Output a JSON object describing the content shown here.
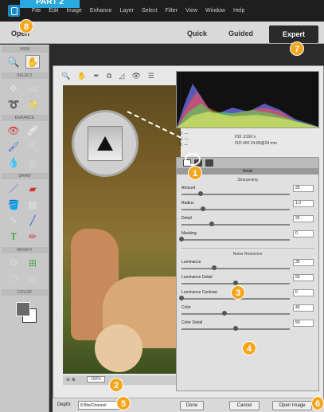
{
  "banner": "PART 2",
  "menu": [
    "File",
    "Edit",
    "Image",
    "Enhance",
    "Layer",
    "Select",
    "Filter",
    "View",
    "Window",
    "Help"
  ],
  "modebar": {
    "open": "Open",
    "quick": "Quick",
    "guided": "Guided",
    "expert": "Expert"
  },
  "tool_sections": [
    "VIEW",
    "SELECT",
    "ENHANCE",
    "DRAW",
    "MODIFY",
    "COLOR"
  ],
  "readout": {
    "r": "R:",
    "g": "G:",
    "b": "B:",
    "dashes": "---",
    "exposure": "f/16  1/160 s",
    "iso": "ISO 400  24-85@24 mm"
  },
  "panel": {
    "title": "Detail",
    "sharpening_title": "Sharpening",
    "sharpening": [
      {
        "label": "Amount",
        "value": "25",
        "pos": 0.18
      },
      {
        "label": "Radius",
        "value": "1.0",
        "pos": 0.2
      },
      {
        "label": "Detail",
        "value": "25",
        "pos": 0.28
      },
      {
        "label": "Masking",
        "value": "0",
        "pos": 0.0
      }
    ],
    "noise_title": "Noise Reduction",
    "noise": [
      {
        "label": "Luminance",
        "value": "30",
        "pos": 0.3
      },
      {
        "label": "Luminance Detail",
        "value": "50",
        "pos": 0.5
      },
      {
        "label": "Luminance Contrast",
        "value": "0",
        "pos": 0.0
      },
      {
        "label": "Color",
        "value": "40",
        "pos": 0.4
      },
      {
        "label": "Color Detail",
        "value": "50",
        "pos": 0.5
      }
    ]
  },
  "zoom": {
    "value": "100%"
  },
  "footer": {
    "depth_label": "Depth:",
    "depth_value": "8 Bits/Channel",
    "done": "Done",
    "cancel": "Cancel",
    "open_image": "Open Image"
  },
  "badges": [
    "1",
    "2",
    "3",
    "4",
    "5",
    "6",
    "7",
    "8"
  ],
  "colors": {
    "accent": "#f7a51c",
    "banner": "#29a9e0"
  }
}
